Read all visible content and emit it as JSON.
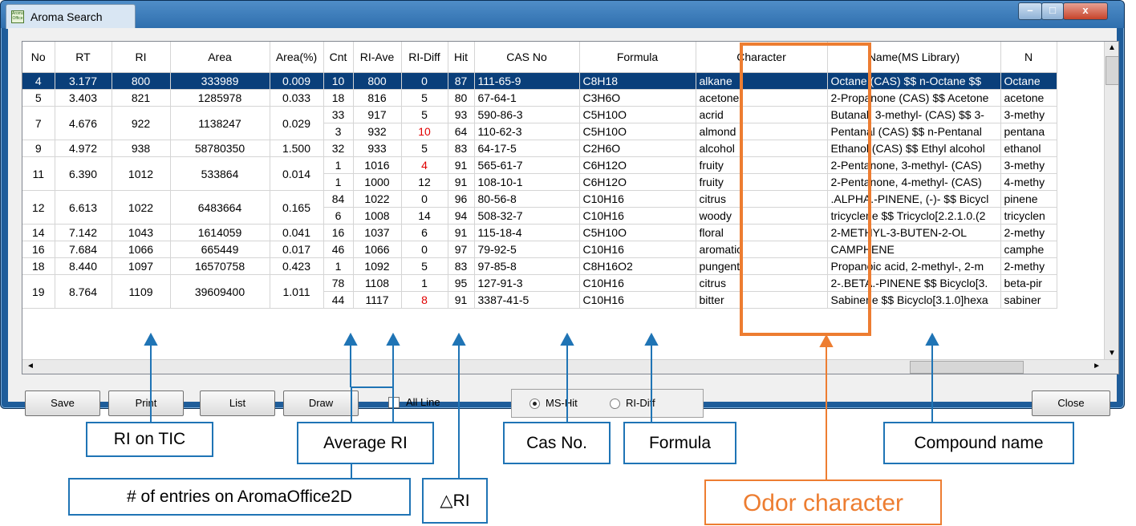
{
  "window": {
    "title": "Aroma Search",
    "app_icon_text": "Aroma Office",
    "min_label": "–",
    "max_label": "□",
    "close_label": "x"
  },
  "table": {
    "columns": [
      "No",
      "RT",
      "RI",
      "Area",
      "Area(%)",
      "Cnt",
      "RI-Ave",
      "RI-Diff",
      "Hit",
      "CAS No",
      "Formula",
      "Character",
      "Name(MS Library)",
      "N"
    ],
    "rows": [
      {
        "no": "4",
        "rt": "3.177",
        "ri": "800",
        "area": "333989",
        "area_pct": "0.009",
        "cnt": "10",
        "ri_ave": "800",
        "ri_diff": "0",
        "hit": "87",
        "cas": "111-65-9",
        "formula": "C8H18",
        "character": "alkane",
        "name": "Octane (CAS) $$ n-Octane $$",
        "n": "Octane"
      },
      {
        "no": "5",
        "rt": "3.403",
        "ri": "821",
        "area": "1285978",
        "area_pct": "0.033",
        "cnt": "18",
        "ri_ave": "816",
        "ri_diff": "5",
        "hit": "80",
        "cas": "67-64-1",
        "formula": "C3H6O",
        "character": "acetone",
        "name": "2-Propanone (CAS) $$ Acetone",
        "n": "acetone"
      },
      {
        "no": "7",
        "rt": "4.676",
        "ri": "922",
        "area": "1138247",
        "area_pct": "0.029",
        "cnt": "33",
        "ri_ave": "917",
        "ri_diff": "5",
        "hit": "93",
        "cas": "590-86-3",
        "formula": "C5H10O",
        "character": "acrid",
        "name": "Butanal, 3-methyl- (CAS) $$ 3-",
        "n": "3-methy"
      },
      {
        "cnt": "3",
        "ri_ave": "932",
        "ri_diff": "10",
        "hit": "64",
        "cas": "110-62-3",
        "formula": "C5H10O",
        "character": "almond",
        "name": "Pentanal (CAS) $$ n-Pentanal",
        "n": "pentana"
      },
      {
        "no": "9",
        "rt": "4.972",
        "ri": "938",
        "area": "58780350",
        "area_pct": "1.500",
        "cnt": "32",
        "ri_ave": "933",
        "ri_diff": "5",
        "hit": "83",
        "cas": "64-17-5",
        "formula": "C2H6O",
        "character": "alcohol",
        "name": "Ethanol (CAS) $$ Ethyl alcohol",
        "n": "ethanol"
      },
      {
        "no": "11",
        "rt": "6.390",
        "ri": "1012",
        "area": "533864",
        "area_pct": "0.014",
        "cnt": "1",
        "ri_ave": "1016",
        "ri_diff": "4",
        "hit": "91",
        "cas": "565-61-7",
        "formula": "C6H12O",
        "character": "fruity",
        "name": "2-Pentanone, 3-methyl- (CAS)",
        "n": "3-methy"
      },
      {
        "cnt": "1",
        "ri_ave": "1000",
        "ri_diff": "12",
        "hit": "91",
        "cas": "108-10-1",
        "formula": "C6H12O",
        "character": "fruity",
        "name": "2-Pentanone, 4-methyl- (CAS)",
        "n": "4-methy"
      },
      {
        "no": "12",
        "rt": "6.613",
        "ri": "1022",
        "area": "6483664",
        "area_pct": "0.165",
        "cnt": "84",
        "ri_ave": "1022",
        "ri_diff": "0",
        "hit": "96",
        "cas": "80-56-8",
        "formula": "C10H16",
        "character": "citrus",
        "name": ".ALPHA.-PINENE, (-)- $$ Bicycl",
        "n": "pinene"
      },
      {
        "cnt": "6",
        "ri_ave": "1008",
        "ri_diff": "14",
        "hit": "94",
        "cas": "508-32-7",
        "formula": "C10H16",
        "character": "woody",
        "name": "tricyclene $$ Tricyclo[2.2.1.0.(2",
        "n": "tricyclen"
      },
      {
        "no": "14",
        "rt": "7.142",
        "ri": "1043",
        "area": "1614059",
        "area_pct": "0.041",
        "cnt": "16",
        "ri_ave": "1037",
        "ri_diff": "6",
        "hit": "91",
        "cas": "115-18-4",
        "formula": "C5H10O",
        "character": "floral",
        "name": "2-METHYL-3-BUTEN-2-OL",
        "n": "2-methy"
      },
      {
        "no": "16",
        "rt": "7.684",
        "ri": "1066",
        "area": "665449",
        "area_pct": "0.017",
        "cnt": "46",
        "ri_ave": "1066",
        "ri_diff": "0",
        "hit": "97",
        "cas": "79-92-5",
        "formula": "C10H16",
        "character": "aromatic",
        "name": "CAMPHENE",
        "n": "camphe"
      },
      {
        "no": "18",
        "rt": "8.440",
        "ri": "1097",
        "area": "16570758",
        "area_pct": "0.423",
        "cnt": "1",
        "ri_ave": "1092",
        "ri_diff": "5",
        "hit": "83",
        "cas": "97-85-8",
        "formula": "C8H16O2",
        "character": "pungent",
        "name": "Propanoic acid, 2-methyl-, 2-m",
        "n": "2-methy"
      },
      {
        "no": "19",
        "rt": "8.764",
        "ri": "1109",
        "area": "39609400",
        "area_pct": "1.011",
        "cnt": "78",
        "ri_ave": "1108",
        "ri_diff": "1",
        "hit": "95",
        "cas": "127-91-3",
        "formula": "C10H16",
        "character": "citrus",
        "name": "2-.BETA.-PINENE $$ Bicyclo[3.",
        "n": "beta-pir"
      },
      {
        "cnt": "44",
        "ri_ave": "1117",
        "ri_diff": "8",
        "hit": "91",
        "cas": "3387-41-5",
        "formula": "C10H16",
        "character": "bitter",
        "name": "Sabinene $$ Bicyclo[3.1.0]hexa",
        "n": "sabiner"
      }
    ]
  },
  "buttons": {
    "save": "Save",
    "print": "Print",
    "list": "List",
    "draw": "Draw",
    "close": "Close"
  },
  "checkbox": {
    "label": "All Line",
    "checked": false
  },
  "radio": {
    "ms_hit": "MS-Hit",
    "ri_diff": "RI-Diff",
    "selected": "MS-Hit"
  },
  "annotations": {
    "ri_on_tic": "RI on TIC",
    "average_ri": "Average RI",
    "cas_no": "Cas No.",
    "formula": "Formula",
    "compound_name": "Compound name",
    "entries": "# of entries on AromaOffice2D",
    "delta_ri": "△RI",
    "odor_character": "Odor character"
  },
  "colors": {
    "accent_blue": "#1f74b5",
    "highlight_orange": "#ed7d31",
    "selected_row": "#0a3f7a",
    "red_value": "#e00000"
  }
}
